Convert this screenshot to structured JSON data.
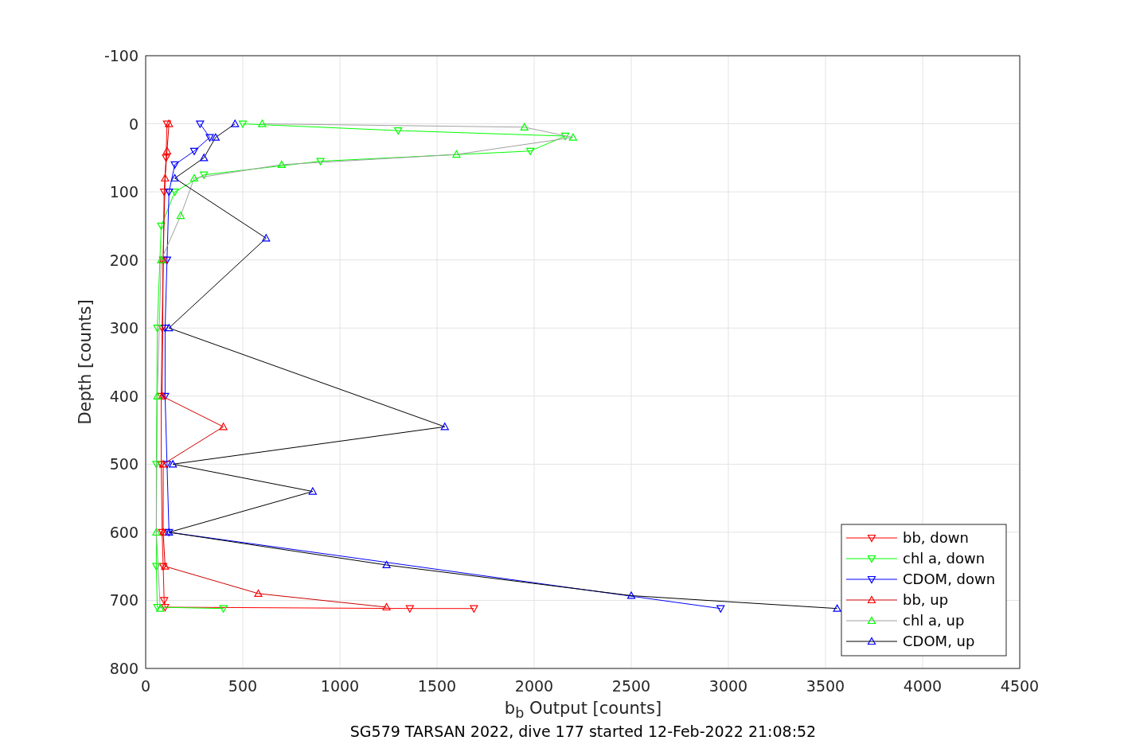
{
  "figure": {
    "chart_data": {
      "type": "line",
      "title": "SG579 TARSAN 2022, dive 177 started 12-Feb-2022 21:08:52",
      "xlabel": "b$_{b}$ Output [counts]",
      "ylabel": "Depth [counts]",
      "xlim": [
        0,
        4500
      ],
      "ylim": [
        800,
        -100
      ],
      "grid": true,
      "legend": true,
      "xticks": [
        0,
        500,
        1000,
        1500,
        2000,
        2500,
        3000,
        3500,
        4000,
        4500
      ],
      "yticks": [
        -100,
        0,
        100,
        200,
        300,
        400,
        500,
        600,
        700,
        800
      ],
      "series": [
        {
          "name": "bb, down",
          "color": "#ff0000",
          "marker": "triangle",
          "x": [
            110,
            105,
            95,
            90,
            85,
            80,
            80,
            85,
            90,
            95,
            100,
            1360,
            1690
          ],
          "values": [
            0,
            50,
            100,
            200,
            300,
            400,
            500,
            600,
            650,
            700,
            710,
            712,
            712
          ]
        },
        {
          "name": "chl a, down",
          "color": "#00ff00",
          "marker": "triangle",
          "x": [
            500,
            1300,
            2160,
            1980,
            900,
            300,
            150,
            80,
            60,
            55,
            55,
            60,
            400
          ],
          "values": [
            0,
            10,
            18,
            40,
            55,
            75,
            100,
            150,
            300,
            500,
            650,
            710,
            712
          ]
        },
        {
          "name": "CDOM, down",
          "color": "#0000ff",
          "marker": "triangle",
          "x": [
            280,
            330,
            250,
            150,
            120,
            110,
            100,
            100,
            110,
            120,
            2960
          ],
          "values": [
            0,
            20,
            40,
            60,
            100,
            200,
            300,
            400,
            500,
            600,
            712
          ]
        },
        {
          "name": "bb, up",
          "color": "#ff0000",
          "marker": "triangle",
          "x": [
            120,
            110,
            100,
            90,
            85,
            400,
            90,
            90,
            100,
            580,
            1240
          ],
          "values": [
            0,
            40,
            80,
            200,
            400,
            445,
            500,
            600,
            650,
            690,
            710
          ]
        },
        {
          "name": "chl a, up",
          "color": "#00ff00",
          "marker": "triangle",
          "x": [
            600,
            1950,
            2200,
            1600,
            700,
            250,
            180,
            80,
            60,
            55,
            75
          ],
          "values": [
            0,
            5,
            20,
            45,
            60,
            80,
            135,
            200,
            400,
            600,
            712
          ]
        },
        {
          "name": "CDOM, up",
          "color": "#0000ff",
          "marker": "triangle",
          "x": [
            460,
            360,
            300,
            150,
            620,
            120,
            1540,
            140,
            860,
            120,
            1240,
            2500,
            3560
          ],
          "values": [
            0,
            20,
            50,
            80,
            168,
            300,
            445,
            500,
            540,
            600,
            648,
            693,
            712
          ]
        }
      ]
    }
  }
}
